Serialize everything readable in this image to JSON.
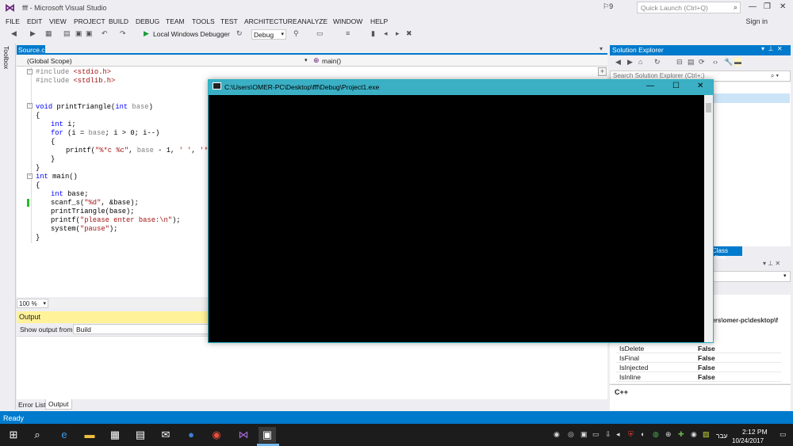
{
  "window": {
    "title": "fff - Microsoft Visual Studio",
    "notifications": "9",
    "quick_launch_placeholder": "Quick Launch (Ctrl+Q)",
    "sign_in": "Sign in"
  },
  "menu": [
    "FILE",
    "EDIT",
    "VIEW",
    "PROJECT",
    "BUILD",
    "DEBUG",
    "TEAM",
    "TOOLS",
    "TEST",
    "ARCHITECTURE",
    "ANALYZE",
    "WINDOW",
    "HELP"
  ],
  "toolbar": {
    "debugger": "Local Windows Debugger",
    "configuration": "Debug"
  },
  "toolbox_label": "Toolbox",
  "editor": {
    "tab": "Source.c",
    "scope": "(Global Scope)",
    "function": "main()",
    "zoom": "100 %",
    "code": {
      "l1_pp": "#include ",
      "l1_hdr": "<stdio.h>",
      "l2_pp": "#include ",
      "l2_hdr": "<stdlib.h>",
      "l5_kw": "void",
      "l5_name": " printTriangle(",
      "l5_kw2": "int",
      "l5_par": " base",
      "l5_end": ")",
      "l6": "{",
      "l7_kw": "int",
      "l7_rest": " i;",
      "l8_kw": "for",
      "l8_a": " (i = ",
      "l8_par": "base",
      "l8_b": "; i > 0; i--)",
      "l9": "{",
      "l10_a": "printf(",
      "l10_str": "\"%*c %c\"",
      "l10_b": ", ",
      "l10_par": "base",
      "l10_c": " - 1, ",
      "l10_str2": "' '",
      "l10_d": ", ",
      "l10_str3": "'*'",
      "l10_e": ");",
      "l11": "}",
      "l12": "}",
      "l13_kw": "int",
      "l13_rest": " main()",
      "l14": "{",
      "l15_kw": "int",
      "l15_rest": " base;",
      "l16_a": "scanf_s(",
      "l16_str": "\"%d\"",
      "l16_b": ", &base);",
      "l17": "printTriangle(base);",
      "l18_a": "printf(",
      "l18_str": "\"please enter base:\\n\"",
      "l18_b": ");",
      "l19_a": "system(",
      "l19_str": "\"pause\"",
      "l19_b": ");",
      "l20": "}"
    }
  },
  "output": {
    "title": "Output",
    "show_from_label": "Show output from:",
    "source": "Build",
    "tabs": [
      "Error List",
      "Output"
    ]
  },
  "solution_explorer": {
    "title": "Solution Explorer",
    "search_placeholder": "Search Solution Explorer (Ctrl+;)",
    "class_view_tab": "Class View"
  },
  "properties": {
    "path": "sers\\omer-pc\\desktop\\f",
    "rows": [
      {
        "name": "IsDelete",
        "value": "False"
      },
      {
        "name": "IsFinal",
        "value": "False"
      },
      {
        "name": "IsInjected",
        "value": "False"
      },
      {
        "name": "IsInline",
        "value": "False"
      }
    ],
    "description": "C++"
  },
  "console": {
    "title": "C:\\Users\\OMER-PC\\Desktop\\fff\\Debug\\Project1.exe"
  },
  "status": {
    "text": "Ready"
  },
  "taskbar": {
    "time": "2:12 PM",
    "date": "10/24/2017",
    "language": "עבר"
  }
}
